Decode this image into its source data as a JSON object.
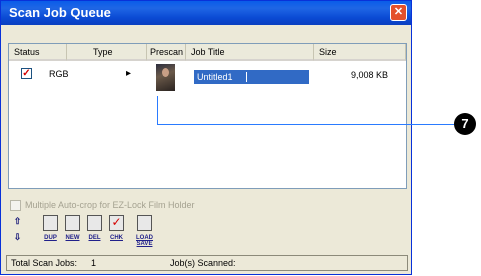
{
  "window": {
    "title": "Scan Job Queue",
    "close_symbol": "✕"
  },
  "list": {
    "columns": [
      "Status",
      "Type",
      "Prescan",
      "Job Title",
      "Size"
    ],
    "row": {
      "status_checked": true,
      "type": "RGB",
      "expand_symbol": "▸",
      "job_title": "Untitled1",
      "size": "9,008 KB"
    }
  },
  "autocrop": {
    "label": "Multiple Auto-crop for EZ-Lock Film Holder",
    "enabled": false
  },
  "toolbar": {
    "up_symbol": "⇧",
    "down_symbol": "⇩",
    "dup": "DUP",
    "new": "NEW",
    "del": "DEL",
    "chk": "CHK",
    "load_save": "LOAD SAVE"
  },
  "status": {
    "total_label": "Total Scan Jobs:",
    "total_value": "1",
    "scanned_label": "Job(s) Scanned:"
  },
  "callout": {
    "number": "7"
  },
  "colors": {
    "titlebar": "#0a5ce9",
    "selection": "#316ac5",
    "callout_line": "#2a7bff"
  }
}
